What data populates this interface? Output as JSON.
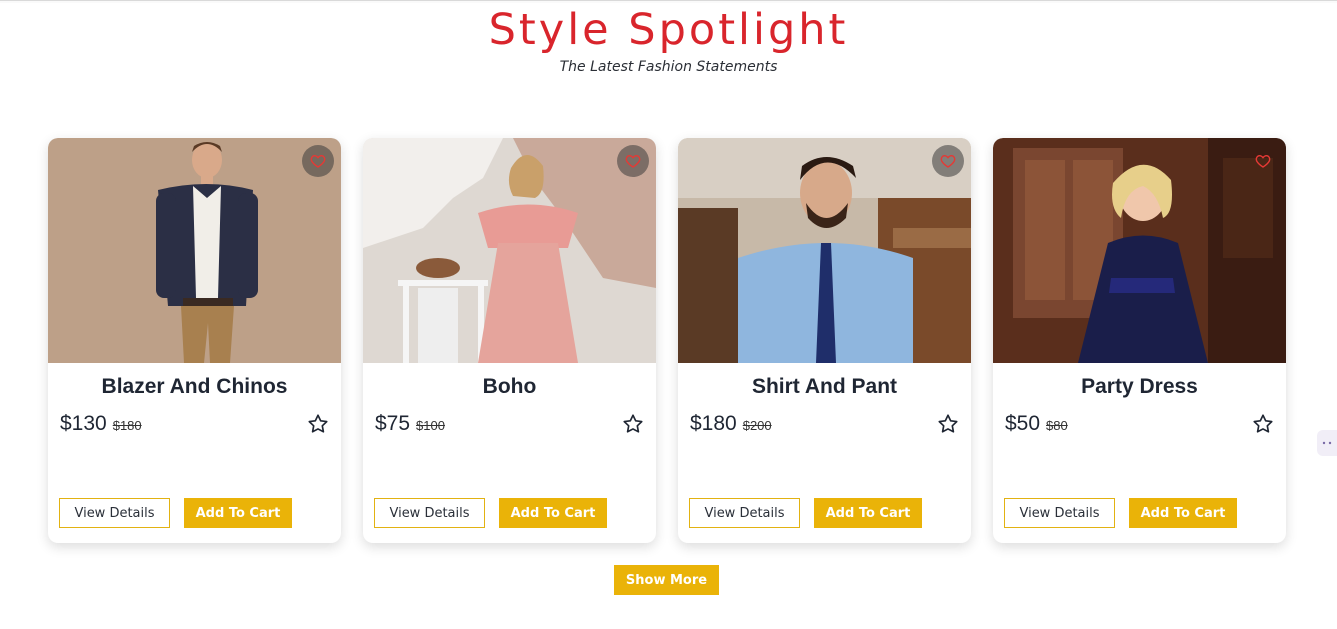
{
  "header": {
    "title": "Style Spotlight",
    "subtitle": "The Latest Fashion Statements"
  },
  "products": [
    {
      "name": "Blazer And Chinos",
      "price": "$130",
      "old_price": "$180",
      "details_label": "View Details",
      "cart_label": "Add To Cart"
    },
    {
      "name": "Boho",
      "price": "$75",
      "old_price": "$100",
      "details_label": "View Details",
      "cart_label": "Add To Cart"
    },
    {
      "name": "Shirt And Pant",
      "price": "$180",
      "old_price": "$200",
      "details_label": "View Details",
      "cart_label": "Add To Cart"
    },
    {
      "name": "Party Dress",
      "price": "$50",
      "old_price": "$80",
      "details_label": "View Details",
      "cart_label": "Add To Cart"
    }
  ],
  "show_more_label": "Show More",
  "icons": {
    "favorite": "heart-icon",
    "rating": "star-icon"
  },
  "colors": {
    "title": "#d9252c",
    "accent": "#eab308",
    "heart": "#e53935"
  }
}
